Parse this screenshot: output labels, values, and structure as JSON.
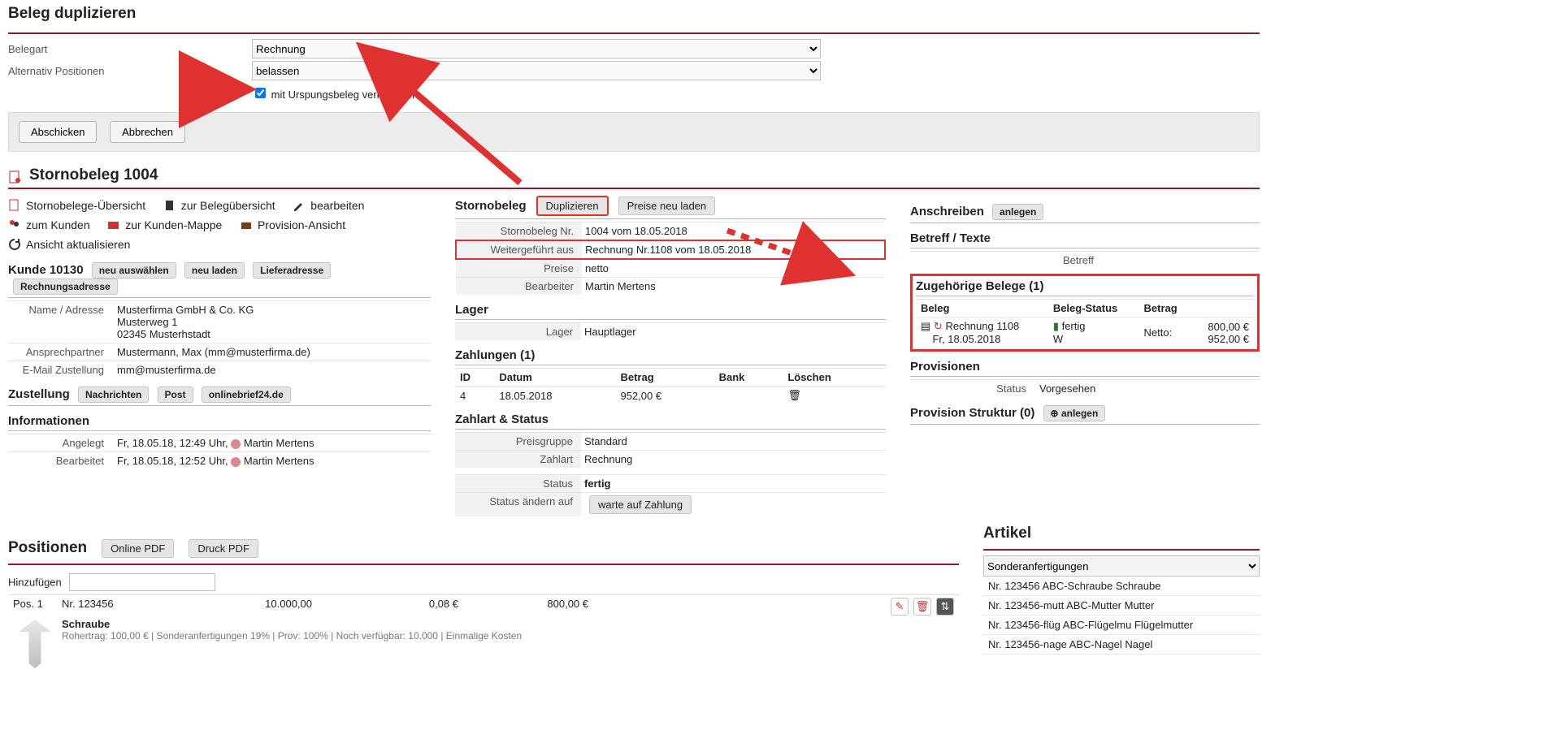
{
  "dup": {
    "title": "Beleg duplizieren",
    "belegart_label": "Belegart",
    "belegart_value": "Rechnung",
    "altpos_label": "Alternativ Positionen",
    "altpos_value": "belassen",
    "chk_label": "mit Urspungsbeleg verknüpfen",
    "submit": "Abschicken",
    "cancel": "Abbrechen"
  },
  "header": {
    "title": "Stornobeleg 1004"
  },
  "left": {
    "links": {
      "uebersicht": "Stornobelege-Übersicht",
      "beleguebersicht": "zur Belegübersicht",
      "bearbeiten": "bearbeiten",
      "zumkunden": "zum Kunden",
      "kundenmappe": "zur Kunden-Mappe",
      "provision": "Provision-Ansicht",
      "refresh": "Ansicht aktualisieren"
    },
    "kunde": {
      "title": "Kunde 10130",
      "btn_neu_auswaehlen": "neu auswählen",
      "btn_neu_laden": "neu laden",
      "btn_liefer": "Lieferadresse",
      "btn_rechnung": "Rechnungsadresse",
      "name_label": "Name / Adresse",
      "name_val1": "Musterfirma GmbH & Co. KG",
      "name_val2": "Musterweg 1",
      "name_val3": "02345 Musterhstadt",
      "ap_label": "Ansprechpartner",
      "ap_val": "Mustermann, Max (mm@musterfirma.de)",
      "email_label": "E-Mail Zustellung",
      "email_val": "mm@musterfirma.de"
    },
    "zustellung": {
      "title": "Zustellung",
      "btn_nachrichten": "Nachrichten",
      "btn_post": "Post",
      "btn_onlinebrief": "onlinebrief24.de"
    },
    "info": {
      "title": "Informationen",
      "angelegt_label": "Angelegt",
      "angelegt_val": "Fr, 18.05.18, 12:49 Uhr, ",
      "angelegt_person": "Martin Mertens",
      "bearbeitet_label": "Bearbeitet",
      "bearbeitet_val": "Fr, 18.05.18, 12:52 Uhr, ",
      "bearbeitet_person": "Martin Mertens"
    }
  },
  "mid": {
    "sb_title": "Stornobeleg",
    "dup_btn": "Duplizieren",
    "preise_btn": "Preise neu laden",
    "sbnr_label": "Stornobeleg Nr.",
    "sbnr_val": "1004 vom 18.05.2018",
    "wf_label": "Weitergeführt aus",
    "wf_val": "Rechnung Nr.1108 vom 18.05.2018",
    "preise_label": "Preise",
    "preise_val": "netto",
    "bearb_label": "Bearbeiter",
    "bearb_val": "Martin Mertens",
    "lager_title": "Lager",
    "lager_label": "Lager",
    "lager_val": "Hauptlager",
    "zahl_title": "Zahlungen (1)",
    "th_id": "ID",
    "th_datum": "Datum",
    "th_betrag": "Betrag",
    "th_bank": "Bank",
    "th_loeschen": "Löschen",
    "pay_id": "4",
    "pay_datum": "18.05.2018",
    "pay_betrag": "952,00 €",
    "zs_title": "Zahlart & Status",
    "pg_label": "Preisgruppe",
    "pg_val": "Standard",
    "za_label": "Zahlart",
    "za_val": "Rechnung",
    "st_label": "Status",
    "st_val": "fertig",
    "sa_label": "Status ändern auf",
    "sa_btn": "warte auf Zahlung"
  },
  "right": {
    "an_title": "Anschreiben",
    "an_btn": "anlegen",
    "bt_title": "Betreff / Texte",
    "bt_label": "Betreff",
    "zg_title": "Zugehörige Belege (1)",
    "th_beleg": "Beleg",
    "th_status": "Beleg-Status",
    "th_betrag": "Betrag",
    "beleg_name": "Rechnung 1108",
    "beleg_date": "Fr, 18.05.2018",
    "status_val": "fertig",
    "status_w": "W",
    "betrag_l": "Netto:",
    "betrag_v1": "800,00 €",
    "betrag_v2": "952,00 €",
    "prov_title": "Provisionen",
    "prov_label": "Status",
    "prov_val": "Vorgesehen",
    "ps_title": "Provision Struktur (0)",
    "ps_btn": "anlegen"
  },
  "positionen": {
    "title": "Positionen",
    "btn_online": "Online PDF",
    "btn_druck": "Druck PDF",
    "hinzu_label": "Hinzufügen",
    "pos": "Pos. 1",
    "nr": "Nr. 123456",
    "menge": "10.000,00",
    "preis": "0,08 €",
    "summe": "800,00 €",
    "name": "Schraube",
    "detail": "Rohertrag: 100,00 € | Sonderanfertigungen 19% | Prov: 100% | Noch verfügbar: 10.000 | Einmalige Kosten"
  },
  "artikel": {
    "title": "Artikel",
    "sel": "Sonderanfertigungen",
    "a1": "Nr. 123456 ABC-Schraube Schraube",
    "a2": "Nr. 123456-mutt ABC-Mutter Mutter",
    "a3": "Nr. 123456-flüg ABC-Flügelmu Flügelmutter",
    "a4": "Nr. 123456-nage ABC-Nagel Nagel"
  }
}
